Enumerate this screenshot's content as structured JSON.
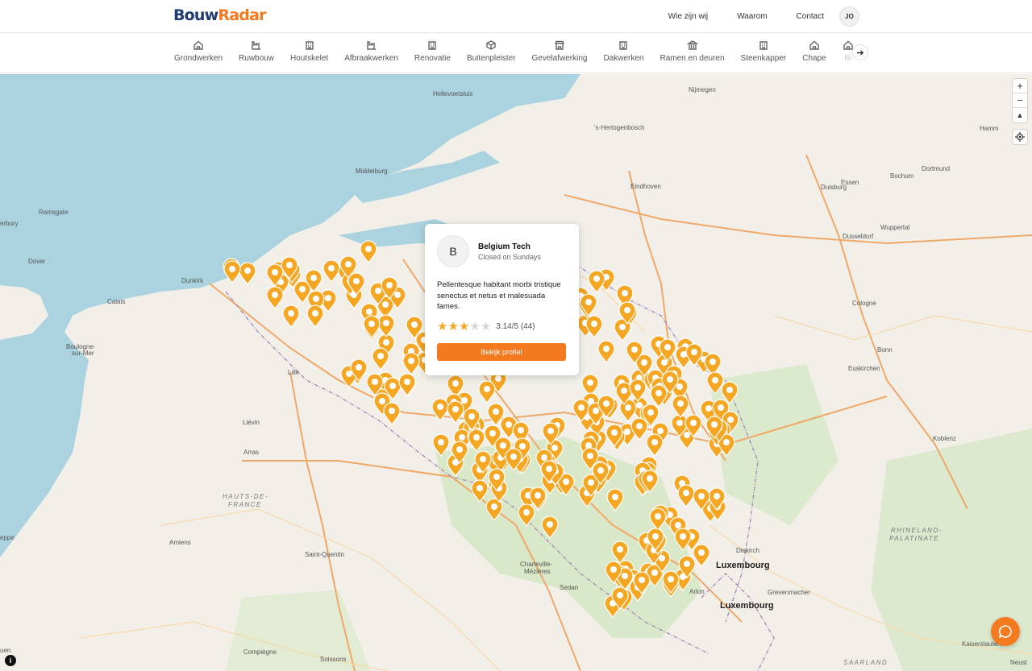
{
  "header": {
    "logo_part1": "Bouw",
    "logo_part2": "Radar",
    "nav": [
      "Wie zijn wij",
      "Waarom",
      "Contact"
    ],
    "user_initials": "JO"
  },
  "categories": [
    {
      "label": "Grondwerken",
      "icon": "house-icon"
    },
    {
      "label": "Ruwbouw",
      "icon": "factory-icon"
    },
    {
      "label": "Houtskelet",
      "icon": "building-icon"
    },
    {
      "label": "Afbraakwerken",
      "icon": "factory-icon"
    },
    {
      "label": "Renovatie",
      "icon": "building-icon"
    },
    {
      "label": "Buitenpleister",
      "icon": "box-icon"
    },
    {
      "label": "Gevelafwerking",
      "icon": "store-icon"
    },
    {
      "label": "Dakwerken",
      "icon": "building-icon"
    },
    {
      "label": "Ramen en deuren",
      "icon": "landmark-icon"
    },
    {
      "label": "Steenkapper",
      "icon": "building-icon"
    },
    {
      "label": "Chape",
      "icon": "house-icon"
    },
    {
      "label": "Bi",
      "icon": "house-icon"
    }
  ],
  "map": {
    "labels": [
      {
        "text": "Hellevoetsluis",
        "cls": ""
      },
      {
        "text": "Nijmegen",
        "cls": ""
      },
      {
        "text": "'s-Hertogenbosch",
        "cls": ""
      },
      {
        "text": "Hamm",
        "cls": ""
      },
      {
        "text": "Middelburg",
        "cls": ""
      },
      {
        "text": "Dortmund",
        "cls": ""
      },
      {
        "text": "Bochum",
        "cls": ""
      },
      {
        "text": "Essen",
        "cls": ""
      },
      {
        "text": "Duisburg",
        "cls": ""
      },
      {
        "text": "Eindhoven",
        "cls": ""
      },
      {
        "text": "Ramsgate",
        "cls": ""
      },
      {
        "text": "erbury",
        "cls": ""
      },
      {
        "text": "Wuppertal",
        "cls": ""
      },
      {
        "text": "Dusseldorf",
        "cls": ""
      },
      {
        "text": "Dover",
        "cls": ""
      },
      {
        "text": "Dunkirk",
        "cls": ""
      },
      {
        "text": "Calais",
        "cls": ""
      },
      {
        "text": "Cologne",
        "cls": ""
      },
      {
        "text": "Boulogne-",
        "cls": ""
      },
      {
        "text": "sur-Mer",
        "cls": ""
      },
      {
        "text": "Bonn",
        "cls": ""
      },
      {
        "text": "Lille",
        "cls": ""
      },
      {
        "text": "Euskirchen",
        "cls": ""
      },
      {
        "text": "Liévin",
        "cls": ""
      },
      {
        "text": "Koblenz",
        "cls": ""
      },
      {
        "text": "Arras",
        "cls": ""
      },
      {
        "text": "HAUTS-DE-",
        "cls": "region"
      },
      {
        "text": "FRANCE",
        "cls": "region"
      },
      {
        "text": "RHINELAND-",
        "cls": "region"
      },
      {
        "text": "PALATINATE",
        "cls": "region"
      },
      {
        "text": "Amiens",
        "cls": ""
      },
      {
        "text": "eppe",
        "cls": ""
      },
      {
        "text": "Diekirch",
        "cls": ""
      },
      {
        "text": "Saint-Quentin",
        "cls": ""
      },
      {
        "text": "Charleville-",
        "cls": ""
      },
      {
        "text": "Mézières",
        "cls": ""
      },
      {
        "text": "Luxembourg",
        "cls": "big"
      },
      {
        "text": "Sedan",
        "cls": ""
      },
      {
        "text": "Arlon",
        "cls": ""
      },
      {
        "text": "Grevenmacher",
        "cls": ""
      },
      {
        "text": "Luxembourg",
        "cls": "big"
      },
      {
        "text": "Kaiserslautern",
        "cls": ""
      },
      {
        "text": "uen",
        "cls": ""
      },
      {
        "text": "Compiègne",
        "cls": ""
      },
      {
        "text": "Soissons",
        "cls": ""
      },
      {
        "text": "SAARLAND",
        "cls": "region"
      },
      {
        "text": "Neust",
        "cls": ""
      }
    ],
    "zoom_in": "+",
    "zoom_out": "−",
    "compass": "▲",
    "info": "i"
  },
  "popup": {
    "initial": "B",
    "name": "Belgium Tech",
    "status": "Closed on Sundays",
    "description": "Pellentesque habitant morbi tristique senectus et netus et malesuada fames.",
    "rating_value": 3.14,
    "rating_text": "3.14/5 (44)",
    "button": "Bekijk profiel"
  },
  "colors": {
    "accent": "#f47a1f",
    "pin": "#f5a623",
    "star_on": "#f5a623",
    "star_off": "#d6d6d6",
    "sea": "#aad3df",
    "land": "#f2efe9",
    "forest": "#d3e5c4"
  }
}
